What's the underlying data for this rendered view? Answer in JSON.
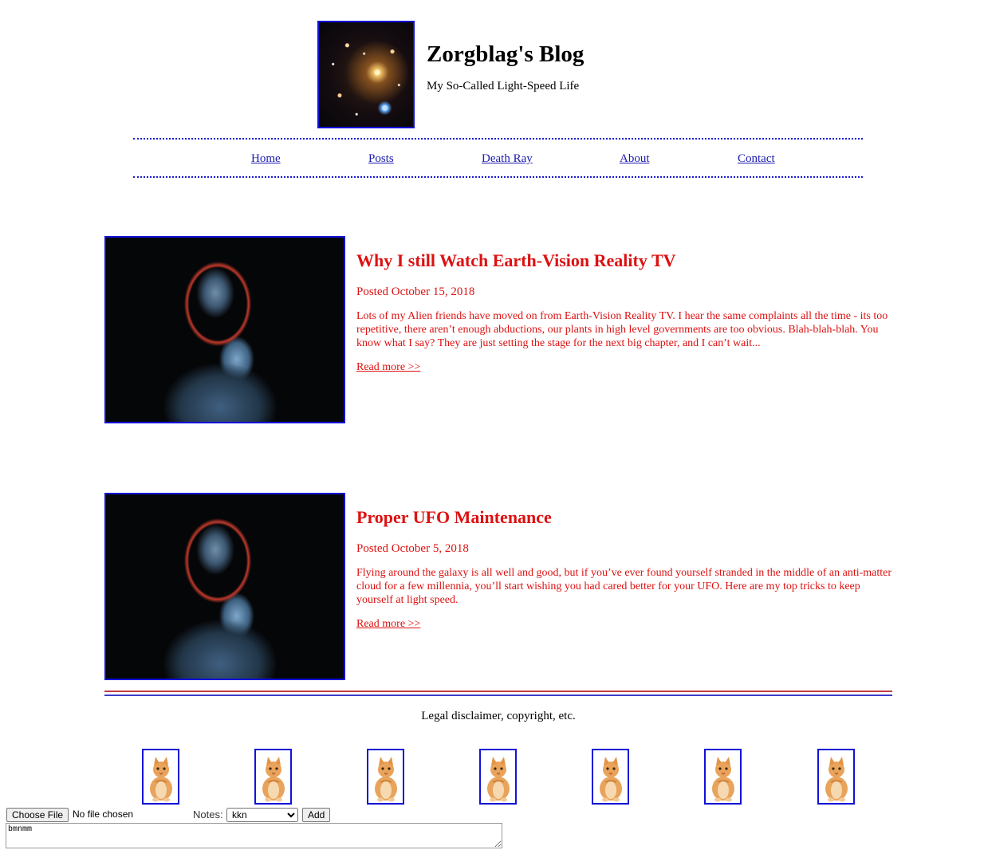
{
  "header": {
    "title": "Zorgblag's Blog",
    "subtitle": "My So-Called Light-Speed Life"
  },
  "nav": {
    "items": [
      {
        "label": "Home"
      },
      {
        "label": "Posts"
      },
      {
        "label": "Death Ray"
      },
      {
        "label": "About"
      },
      {
        "label": "Contact"
      }
    ]
  },
  "posts": [
    {
      "title": "Why I still Watch Earth-Vision Reality TV",
      "date": "Posted October 15, 2018",
      "excerpt": "Lots of my Alien friends have moved on from Earth-Vision Reality TV. I hear the same complaints all the time - its too repetitive, there aren’t enough abductions, our plants in high level governments are too obvious. Blah-blah-blah. You know what I say? They are just setting the stage for the next big chapter, and I can’t wait...",
      "read_more": "Read more >>"
    },
    {
      "title": "Proper UFO Maintenance",
      "date": "Posted October 5, 2018",
      "excerpt": "Flying around the galaxy is all well and good, but if you’ve ever found yourself stranded in the middle of an anti-matter cloud for a few millennia, you’ll start wishing you had cared better for your UFO. Here are my top tricks to keep yourself at light speed.",
      "read_more": "Read more >>"
    }
  ],
  "footer": {
    "disclaimer": "Legal disclaimer, copyright, etc."
  },
  "colors": {
    "accent_red": "#dd1111",
    "border_blue": "#1212d8",
    "link_blue": "#1a1ab0"
  },
  "form": {
    "choose_file_label": "Choose File",
    "file_status": "No file chosen",
    "notes_label": "Notes:",
    "notes_selected": "kkn",
    "add_label": "Add",
    "textarea_value": "bmnmm"
  }
}
